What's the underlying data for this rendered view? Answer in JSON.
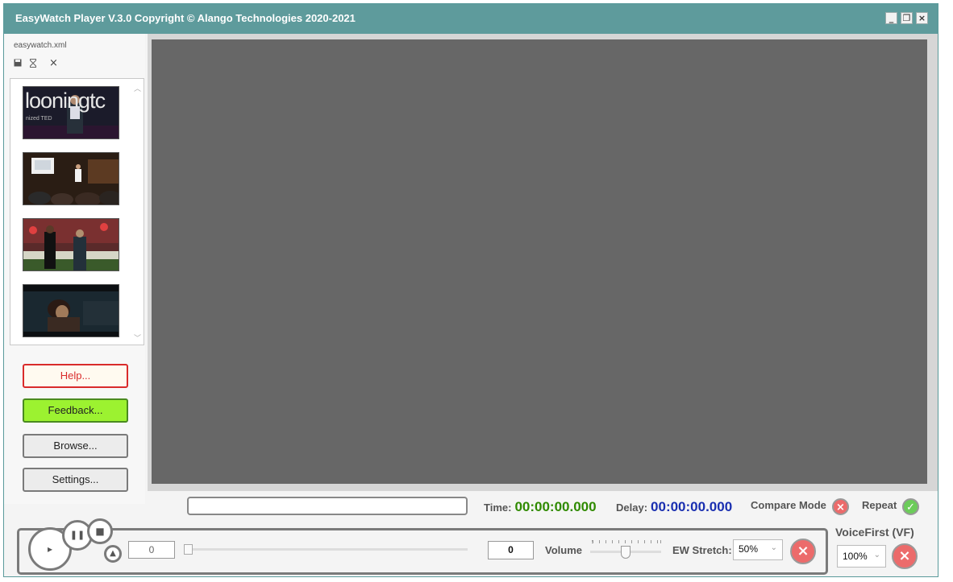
{
  "window": {
    "title": "EasyWatch Player V.3.0 Copyright © Alango Technologies 2020-2021",
    "minimize": "_",
    "restore": "❐",
    "close": "×"
  },
  "sidebar": {
    "file_name": "easywatch.xml",
    "icons": [
      "save-icon",
      "hourglass-icon",
      "close-icon"
    ],
    "thumbnails": [
      {
        "label": "looningtc",
        "caption": "nized TED"
      },
      {
        "label": ""
      },
      {
        "label": ""
      },
      {
        "label": ""
      }
    ],
    "buttons": {
      "help": "Help...",
      "feedback": "Feedback...",
      "browse": "Browse...",
      "settings": "Settings..."
    }
  },
  "status": {
    "time_label": "Time:",
    "time_value": "00:00:00.000",
    "delay_label": "Delay:",
    "delay_value": "00:00:00.000",
    "compare_mode_label": "Compare Mode",
    "repeat_label": "Repeat"
  },
  "controls": {
    "position_value": "0",
    "position_level": 0,
    "volume_value": "0",
    "volume_label": "Volume",
    "volume_level": 0.5,
    "ew_stretch_label": "EW Stretch:",
    "ew_stretch_value": "50%",
    "voicefirst_label": "VoiceFirst (VF)",
    "voicefirst_value": "100%"
  },
  "colors": {
    "titlebar": "#5e9b9c",
    "time_value": "#2f8a00",
    "delay_value": "#1a2fb0",
    "help_border": "#d92b2b",
    "help_text": "#d92b2b",
    "feedback_bg": "#9cf230",
    "off_status": "#ec6b6b",
    "on_status": "#6ccc5a"
  }
}
